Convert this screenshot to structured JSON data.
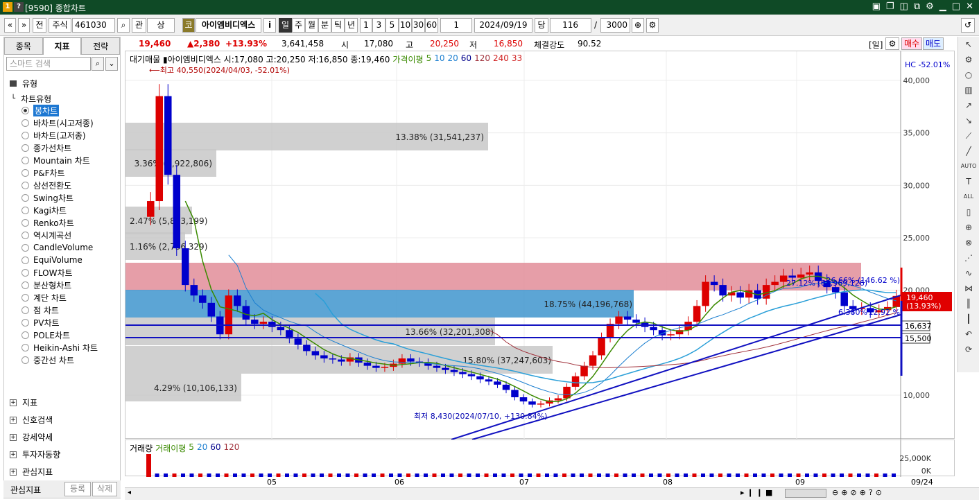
{
  "window": {
    "title": "[9590] 종합차트"
  },
  "toolbar": {
    "code": "461030",
    "market": "주식",
    "prev": "전",
    "rel": "관",
    "sang": "상",
    "gold_label": "코",
    "stock_name": "아이엠비디엑스",
    "info": "i",
    "periods": [
      "일",
      "주",
      "월",
      "분",
      "틱",
      "년"
    ],
    "intervals": [
      "1",
      "3",
      "5",
      "10",
      "30",
      "60"
    ],
    "interval_value": "1",
    "date": "2024/09/19",
    "count_label": "당",
    "count": "116",
    "slash": "/",
    "total": "3000"
  },
  "left": {
    "tabs": [
      "종목",
      "지표",
      "전략"
    ],
    "active_tab": 1,
    "search_placeholder": "스마트 검색",
    "section": "유형",
    "chart_type_header": "차트유형",
    "types": [
      "봉차트",
      "바차트(시고저종)",
      "바차트(고저종)",
      "종가선차트",
      "Mountain 차트",
      "P&F차트",
      "삼선전환도",
      "Swing차트",
      "Kagi차트",
      "Renko차트",
      "역시계곡선",
      "CandleVolume",
      "EquiVolume",
      "FLOW차트",
      "분산형차트",
      "계단 차트",
      "점 차트",
      "PV차트",
      "POLE차트",
      "Heikin-Ashi 차트",
      "중간선 차트"
    ],
    "selected": 0,
    "groups": [
      "지표",
      "신호검색",
      "강세약세",
      "투자자동향",
      "관심지표"
    ],
    "bottom": {
      "label": "관심지표",
      "btn1": "등록",
      "btn2": "삭제"
    }
  },
  "quote": {
    "price": "19,460",
    "change": "▲2,380",
    "pct": "+13.93%",
    "volume": "3,641,458",
    "open_label": "시",
    "open": "17,080",
    "high_label": "고",
    "high": "20,250",
    "low_label": "저",
    "low": "16,850",
    "str_label": "체결강도",
    "str": "90.52",
    "unit": "[일]",
    "buy": "매수",
    "sell": "매도"
  },
  "chart": {
    "legend": "대기매물 ▮아이엠비디엑스 시:17,080 고:20,250 저:16,850 종:19,460",
    "ma_label": "가격이평",
    "ma": [
      "5",
      "10",
      "20",
      "60",
      "120",
      "240",
      "33"
    ],
    "high_note": "최고 40,550(2024/04/03, -52.01%)",
    "low_note": "최저 8,430(2024/07/10, +130.84%)",
    "hc": "HC -52.01%",
    "yticks": [
      "40,000",
      "35,000",
      "30,000",
      "25,000",
      "20,000",
      "15,500",
      "10,000"
    ],
    "xticks": [
      "05",
      "06",
      "07",
      "08",
      "09",
      "09/24"
    ],
    "price_tag": "19,460",
    "price_tag2": "(13.93%)",
    "tag_16637": "16,637",
    "tag_15500": "15,500",
    "vp": [
      {
        "y": 191,
        "w": 523,
        "t": "13.38% (31,541,237)",
        "c": "#c8c8c8"
      },
      {
        "y": 229,
        "w": 131,
        "t": "3.36% (7,922,806)",
        "c": "#c8c8c8"
      },
      {
        "y": 312,
        "w": 96,
        "t": "2.47% (5,813,199)",
        "c": "#c8c8c8"
      },
      {
        "y": 349,
        "w": 86,
        "t": "1.16% (2,736,329)",
        "c": "#c8c8c8"
      },
      {
        "y": 393,
        "w": 1061,
        "t": "",
        "c": "#e3939e"
      },
      {
        "y": 432,
        "w": 733,
        "t": "18.75% (44,196,768)",
        "c": "#4a9bd0"
      },
      {
        "y": 472,
        "w": 533,
        "t": "13.66% (32,201,308)",
        "c": "#c8c8c8"
      },
      {
        "y": 513,
        "w": 616,
        "t": "15.80% (37,247,603)",
        "c": "#c8c8c8"
      },
      {
        "y": 553,
        "w": 167,
        "t": "4.29% (10,106,133)",
        "c": "#c8c8c8"
      }
    ],
    "anno": [
      "26.66% (146.62 %)",
      "12.92 %",
      "27.12% (63,969,126)",
      "6.380%"
    ],
    "vol_label": "거래량",
    "vol_ma": "거래이평",
    "vol_ma_vals": [
      "5",
      "20",
      "60",
      "120"
    ],
    "vol_ticks": [
      "25,000K",
      "0K"
    ]
  }
}
